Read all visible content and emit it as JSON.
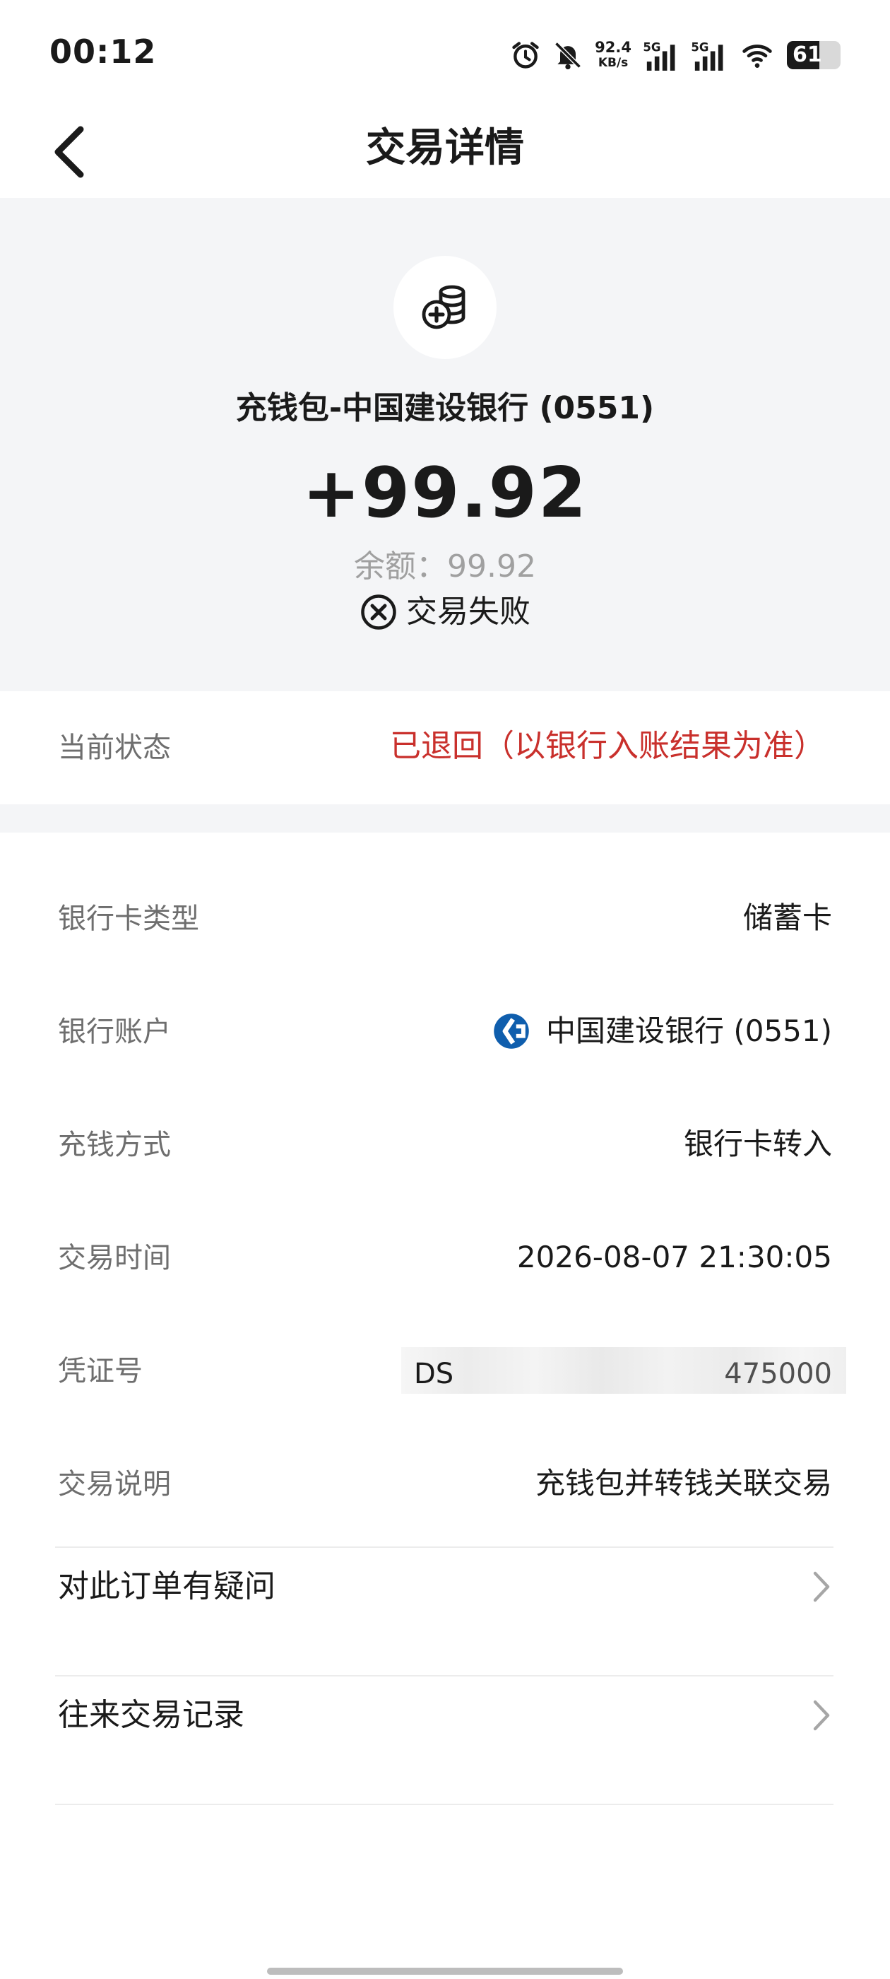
{
  "status_bar": {
    "time": "00:12",
    "net_speed": "92.4",
    "net_unit": "KB/s",
    "signal_label_1": "5G",
    "signal_label_2": "5G",
    "battery_level": "61",
    "icons": [
      "alarm-icon",
      "bell-muted-icon",
      "signal-icon",
      "signal-icon",
      "wifi-icon",
      "battery-icon"
    ]
  },
  "nav": {
    "title": "交易详情",
    "back_icon": "chevron-left-icon"
  },
  "hero": {
    "icon": "coins-plus-icon",
    "title": "充钱包-中国建设银行 (0551)",
    "amount": "+99.92",
    "balance": "余额：99.92",
    "status_icon": "circle-x-icon",
    "status": "交易失败"
  },
  "current_status": {
    "label": "当前状态",
    "value": "已退回（以银行入账结果为准）",
    "color": "#c9302c"
  },
  "details": [
    {
      "label": "银行卡类型",
      "value": "储蓄卡"
    },
    {
      "label": "银行账户",
      "value": "中国建设银行 (0551)",
      "icon": "ccb-bank-logo"
    },
    {
      "label": "充钱方式",
      "value": "银行卡转入"
    },
    {
      "label": "交易时间",
      "value": "2026-08-07 21:30:05"
    },
    {
      "label": "凭证号",
      "value_fragments": [
        "DS",
        "475000"
      ]
    },
    {
      "label": "交易说明",
      "value": "充钱包并转钱关联交易"
    }
  ],
  "links": [
    {
      "label": "对此订单有疑问",
      "icon": "chevron-right-icon"
    },
    {
      "label": "往来交易记录",
      "icon": "chevron-right-icon"
    }
  ],
  "colors": {
    "background": "#ffffff",
    "hero_background": "#f4f5f7",
    "label_gray": "#6e6e6e",
    "error_red": "#c9302c",
    "bank_blue": "#0f5ead"
  }
}
